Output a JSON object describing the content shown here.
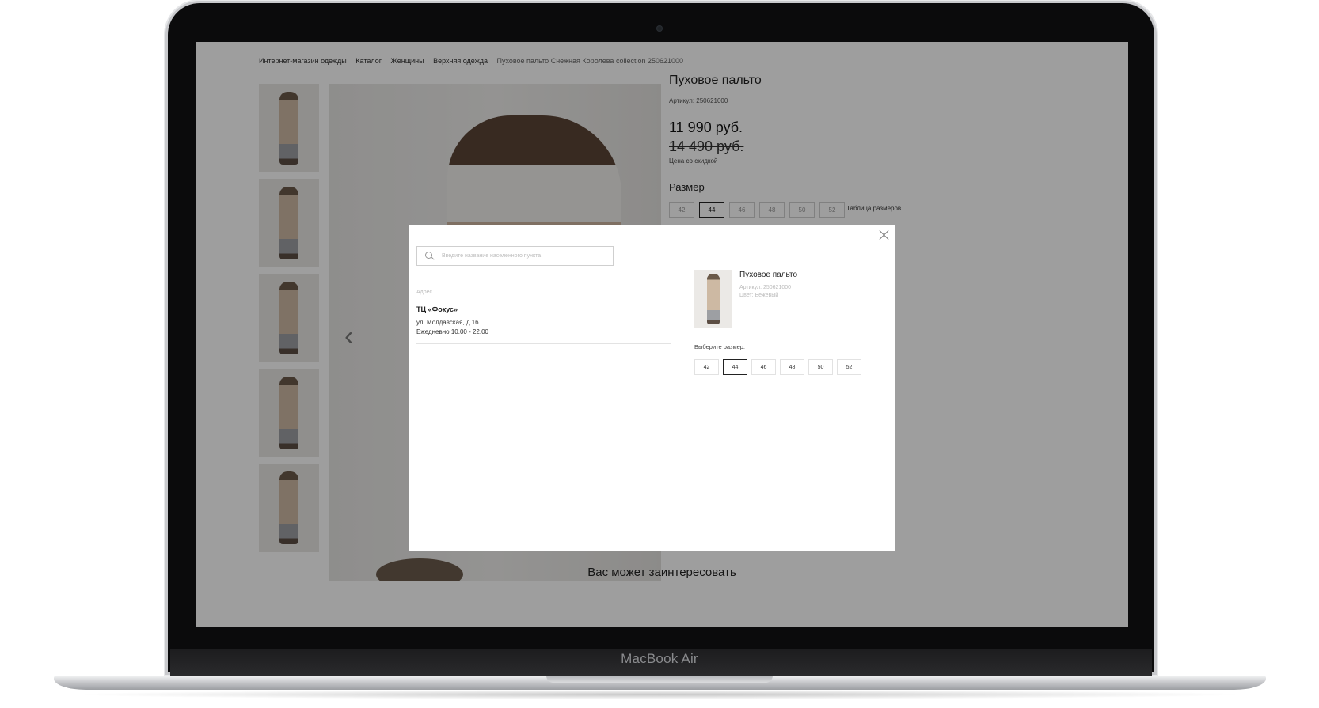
{
  "device": {
    "brand": "MacBook Air"
  },
  "page": {
    "breadcrumb": [
      "Интернет-магазин одежды",
      "Каталог",
      "Женщины",
      "Верхняя одежда",
      "Пуховое пальто Снежная Королева collection 250621000"
    ],
    "product": {
      "title": "Пуховое пальто",
      "article": "Артикул: 250621000",
      "price": "11 990 руб.",
      "old_price": "14 490 руб.",
      "discount_label": "Цена со скидкой",
      "size_label": "Размер",
      "sizes": [
        "42",
        "44",
        "46",
        "48",
        "50",
        "52"
      ],
      "selected_size": "44",
      "size_table_link": "Таблица размеров"
    },
    "interest_heading": "Вас может заинтересовать"
  },
  "modal": {
    "search": {
      "placeholder": "Введите название населенного пункта",
      "value": ""
    },
    "address_heading": "Адрес",
    "store": {
      "name": "ТЦ «Фокус»",
      "street": "ул. Молдавская, д 16",
      "hours": "Ежедневно 10.00 - 22.00"
    },
    "product": {
      "title": "Пуховое пальто",
      "article": "Артикул: 250621000",
      "color": "Цвет: Бежевый"
    },
    "choose_size_label": "Выберите размер:",
    "sizes": [
      "42",
      "44",
      "46",
      "48",
      "50",
      "52"
    ],
    "selected_size": "44"
  },
  "icons": {
    "close": "close-icon",
    "search": "search-icon",
    "prev": "chevron-left-icon"
  }
}
